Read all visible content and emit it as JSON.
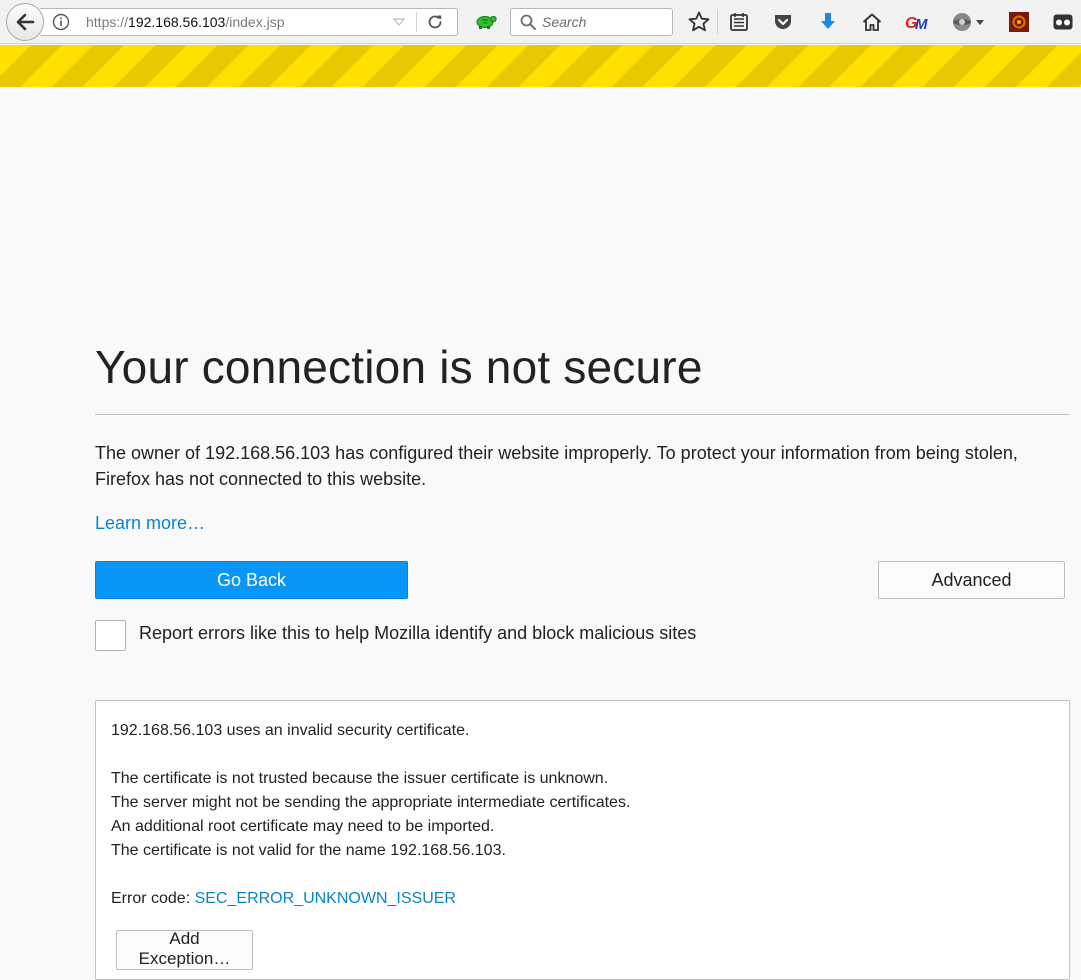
{
  "browser": {
    "url_scheme": "https://",
    "url_host": "192.168.56.103",
    "url_path": "/index.jsp",
    "search_placeholder": "Search",
    "toolbar_icons": [
      "back-arrow-icon",
      "site-info-icon",
      "url-dropdown-icon",
      "reload-icon",
      "turtle-addon-icon",
      "search-icon",
      "bookmark-star-icon",
      "reading-list-icon",
      "pocket-icon",
      "download-arrow-icon",
      "home-icon",
      "gm-addon-icon",
      "addon-menu-icon",
      "dark-addon-icon",
      "extension-icon"
    ]
  },
  "error_page": {
    "title": "Your connection is not secure",
    "description": "The owner of 192.168.56.103 has configured their website improperly. To protect your information from being stolen, Firefox has not connected to this website.",
    "learn_more": "Learn more…",
    "go_back_label": "Go Back",
    "advanced_label": "Advanced",
    "report_label": "Report errors like this to help Mozilla identify and block malicious sites",
    "report_checked": false
  },
  "advanced_panel": {
    "intro": "192.168.56.103 uses an invalid security certificate.",
    "reasons": [
      "The certificate is not trusted because the issuer certificate is unknown.",
      "The server might not be sending the appropriate intermediate certificates.",
      "An additional root certificate may need to be imported.",
      "The certificate is not valid for the name 192.168.56.103."
    ],
    "error_code_label": "Error code: ",
    "error_code": "SEC_ERROR_UNKNOWN_ISSUER",
    "add_exception_label": "Add Exception…"
  },
  "colors": {
    "primary_button": "#0996f8",
    "link": "#0a84c8",
    "stripe_yellow": "#ffe100",
    "stripe_dark": "#e8c800"
  }
}
